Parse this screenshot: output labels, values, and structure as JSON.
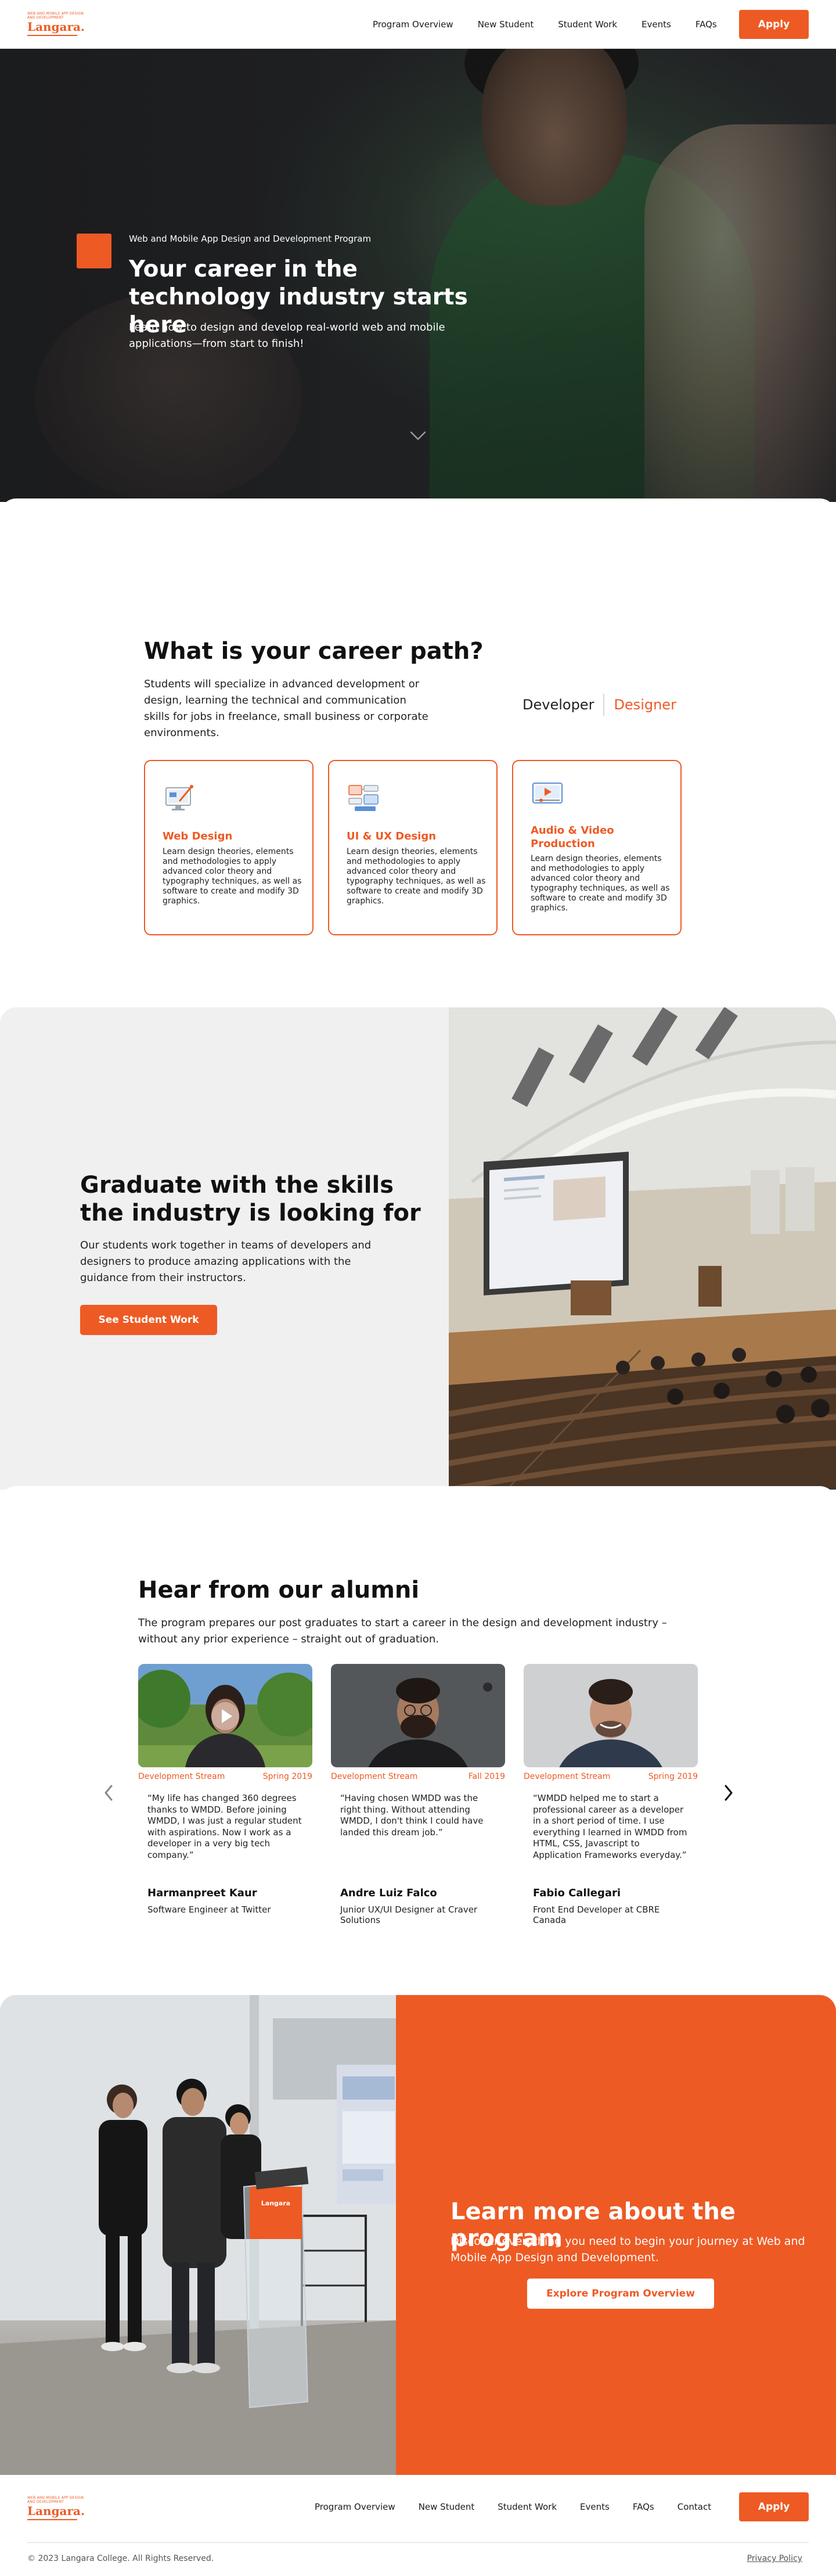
{
  "brand": {
    "tagline": "WEB AND MOBILE APP DESIGN AND DEVELOPMENT",
    "name": "Langara."
  },
  "header": {
    "nav": [
      "Program Overview",
      "New Student",
      "Student Work",
      "Events",
      "FAQs"
    ],
    "apply_label": "Apply"
  },
  "hero": {
    "eyebrow": "Web and Mobile App Design and Development Program",
    "title": "Your career in the technology industry starts here",
    "subtitle": "Learn how to design and develop real-world web and mobile applications—from start to finish!"
  },
  "career": {
    "title": "What is your career path?",
    "description": "Students will specialize in advanced development or design, learning the technical and communication skills for jobs in freelance, small business or corporate environments.",
    "toggle": {
      "option_a": "Developer",
      "option_b": "Designer",
      "selected": "Designer"
    },
    "cards": [
      {
        "icon": "web-design-icon",
        "title": "Web Design",
        "text": "Learn design theories, elements and methodologies to apply advanced color theory and typography techniques, as well as software to create and modify 3D graphics."
      },
      {
        "icon": "ui-ux-design-icon",
        "title": "UI & UX Design",
        "text": "Learn design theories, elements and methodologies to apply advanced color theory and typography techniques, as well as software to create and modify 3D graphics."
      },
      {
        "icon": "video-production-icon",
        "title": "Audio & Video Production",
        "text": "Learn design theories, elements and methodologies to apply advanced color theory and typography techniques, as well as software to create and modify 3D graphics."
      }
    ]
  },
  "graduate": {
    "title": "Graduate with the skills the industry is looking for",
    "subtitle": "Our students work together in teams of developers and designers to produce amazing applications with the guidance from their instructors.",
    "button_label": "See Student Work"
  },
  "alumni": {
    "title": "Hear from our alumni",
    "description": "The program prepares our post graduates to start a career in the design and development industry – without any prior experience – straight out of graduation.",
    "items": [
      {
        "stream": "Development Stream",
        "term": "Spring 2019",
        "quote": "“My life has changed 360 degrees thanks to WMDD. Before joining WMDD, I was just a regular student with aspirations. Now I work as a developer in a very big tech company.”",
        "name": "Harmanpreet Kaur",
        "role": "Software Engineer at Twitter"
      },
      {
        "stream": "Development Stream",
        "term": "Fall 2019",
        "quote": "“Having chosen WMDD was the right thing. Without attending WMDD, I don't think I could have landed this dream job.”",
        "name": "Andre Luiz Falco",
        "role": "Junior UX/UI Designer at Craver Solutions"
      },
      {
        "stream": "Development Stream",
        "term": "Spring 2019",
        "quote": "“WMDD helped me to start a professional career as a developer in a short period of time. I use everything I learned in WMDD from HTML, CSS, Javascript to Application Frameworks everyday.”",
        "name": "Fabio Callegari",
        "role": "Front End Developer at CBRE Canada"
      }
    ]
  },
  "learn_more": {
    "title": "Learn more about the program",
    "subtitle": "Discover everything you need to begin your journey at Web and Mobile App Design and Development.",
    "button_label": "Explore Program Overview",
    "podium_text": "Langara"
  },
  "footer": {
    "nav": [
      "Program Overview",
      "New Student",
      "Student Work",
      "Events",
      "FAQs",
      "Contact"
    ],
    "apply_label": "Apply",
    "copyright": "© 2023 Langara College. All Rights Reserved.",
    "privacy": "Privacy Policy"
  },
  "colors": {
    "accent": "#ee5a24",
    "text": "#1a1a1a",
    "panel_gray": "#f0f0f0"
  }
}
